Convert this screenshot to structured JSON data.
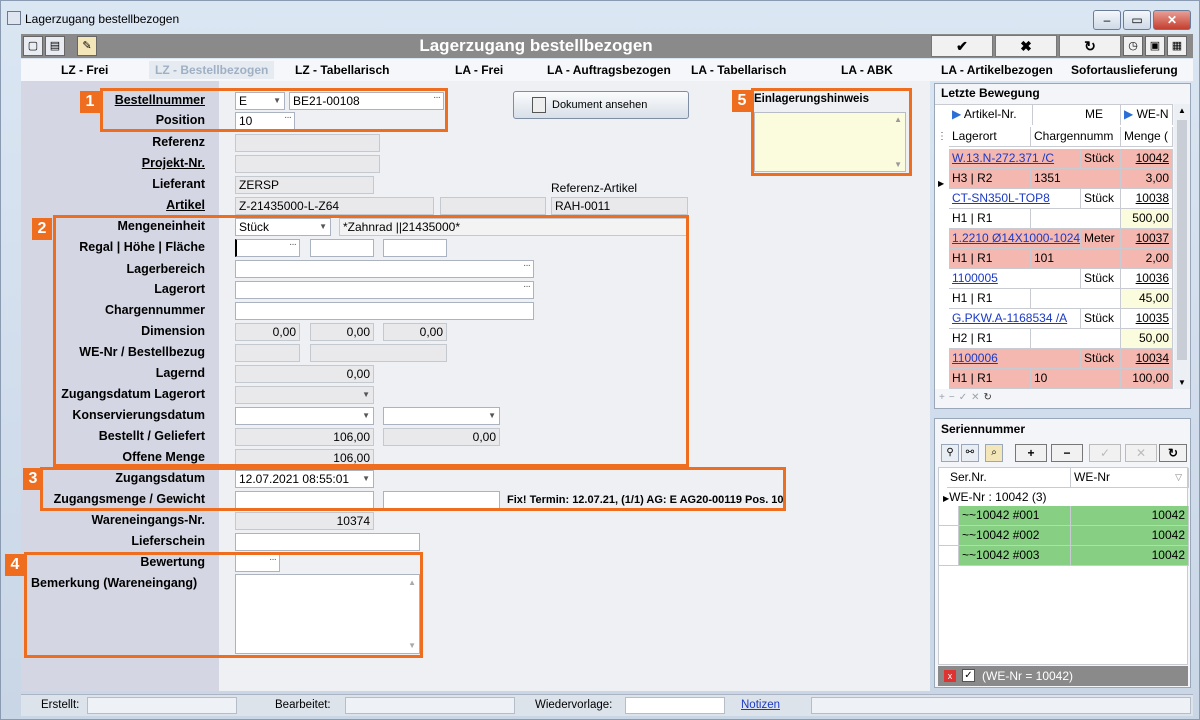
{
  "window": {
    "title": "Lagerzugang bestellbezogen"
  },
  "header": {
    "title": "Lagerzugang bestellbezogen",
    "ok": "✔",
    "cancel": "✖",
    "refresh": "↻"
  },
  "tabs": [
    "LZ - Frei",
    "LZ - Bestellbezogen",
    "LZ - Tabellarisch",
    "LA - Frei",
    "LA - Auftragsbezogen",
    "LA - Tabellarisch",
    "LA - ABK",
    "LA - Artikelbezogen",
    "Sofortauslieferung"
  ],
  "labels": {
    "bestellnummer": "Bestellnummer",
    "position": "Position",
    "referenz": "Referenz",
    "projekt": "Projekt-Nr.",
    "lieferant": "Lieferant",
    "artikel": "Artikel",
    "referenz_artikel": "Referenz-Artikel",
    "mengeneinheit": "Mengeneinheit",
    "regal": "Regal | Höhe | Fläche",
    "lagerbereich": "Lagerbereich",
    "lagerort": "Lagerort",
    "chargennummer": "Chargennummer",
    "dimension": "Dimension",
    "we_nr": "WE-Nr / Bestellbezug",
    "lagernd": "Lagernd",
    "zugangsdatum_lagerort": "Zugangsdatum Lagerort",
    "konservierungsdatum": "Konservierungsdatum",
    "bestellt": "Bestellt / Geliefert",
    "offene_menge": "Offene Menge",
    "zugangsdatum": "Zugangsdatum",
    "zugangsmenge": "Zugangsmenge / Gewicht",
    "wareneingangs_nr": "Wareneingangs-Nr.",
    "lieferschein": "Lieferschein",
    "bewertung": "Bewertung",
    "bemerkung": "Bemerkung (Wareneingang)",
    "einlagerungshinweis": "Einlagerungshinweis"
  },
  "values": {
    "bestell_prefix": "E",
    "bestellnummer": "BE21-00108",
    "position": "10",
    "lieferant": "ZERSP",
    "artikel": "Z-21435000-L-Z64",
    "referenz_artikel": "RAH-0011",
    "mengeneinheit": "Stück",
    "artikel_text": "*Zahnrad   ||21435000*",
    "dim1": "0,00",
    "dim2": "0,00",
    "dim3": "0,00",
    "lagernd": "0,00",
    "bestellt": "106,00",
    "geliefert": "0,00",
    "offene_menge": "106,00",
    "zugangsdatum": "12.07.2021 08:55:01",
    "fix_text": "Fix! Termin: 12.07.21, (1/1) AG: E AG20-00119 Pos. 10",
    "wareneingangs_nr": "10374"
  },
  "doc_button": "Dokument ansehen",
  "markers": [
    "1",
    "2",
    "3",
    "4",
    "5"
  ],
  "letzte_bewegung": {
    "title": "Letzte Bewegung",
    "headers": [
      "Artikel-Nr.",
      "ME",
      "WE-N",
      "Lagerort",
      "Chargennumm",
      "Menge ("
    ],
    "rows": [
      {
        "artikel": "W.13.N-272.371 /C",
        "me": "Stück",
        "we": "10042",
        "lagerort": "H3 | R2",
        "charge": "1351",
        "menge": "3,00",
        "pink": true
      },
      {
        "artikel": "CT-SN350L-TOP8",
        "me": "Stück",
        "we": "10038",
        "lagerort": "H1 | R1",
        "charge": "",
        "menge": "500,00",
        "pink": false
      },
      {
        "artikel": "1.2210 Ø14X1000-1024",
        "me": "Meter",
        "we": "10037",
        "lagerort": "H1 | R1",
        "charge": "101",
        "menge": "2,00",
        "pink": true
      },
      {
        "artikel": "1100005",
        "me": "Stück",
        "we": "10036",
        "lagerort": "H1 | R1",
        "charge": "",
        "menge": "45,00",
        "pink": false
      },
      {
        "artikel": "G.PKW.A-1168534 /A",
        "me": "Stück",
        "we": "10035",
        "lagerort": "H2 | R1",
        "charge": "",
        "menge": "50,00",
        "pink": false
      },
      {
        "artikel": "1100006",
        "me": "Stück",
        "we": "10034",
        "lagerort": "H1 | R1",
        "charge": "10",
        "menge": "100,00",
        "pink": true
      }
    ]
  },
  "seriennummer": {
    "title": "Seriennummer",
    "headers": [
      "Ser.Nr.",
      "WE-Nr"
    ],
    "group": "WE-Nr : 10042 (3)",
    "rows": [
      {
        "ser": "~~10042 #001",
        "we": "10042"
      },
      {
        "ser": "~~10042 #002",
        "we": "10042"
      },
      {
        "ser": "~~10042 #003",
        "we": "10042"
      }
    ],
    "filter": "(WE-Nr = 10042)"
  },
  "status": {
    "erstellt": "Erstellt:",
    "bearbeitet": "Bearbeitet:",
    "wiedervorlage": "Wiedervorlage:",
    "notizen": "Notizen"
  }
}
